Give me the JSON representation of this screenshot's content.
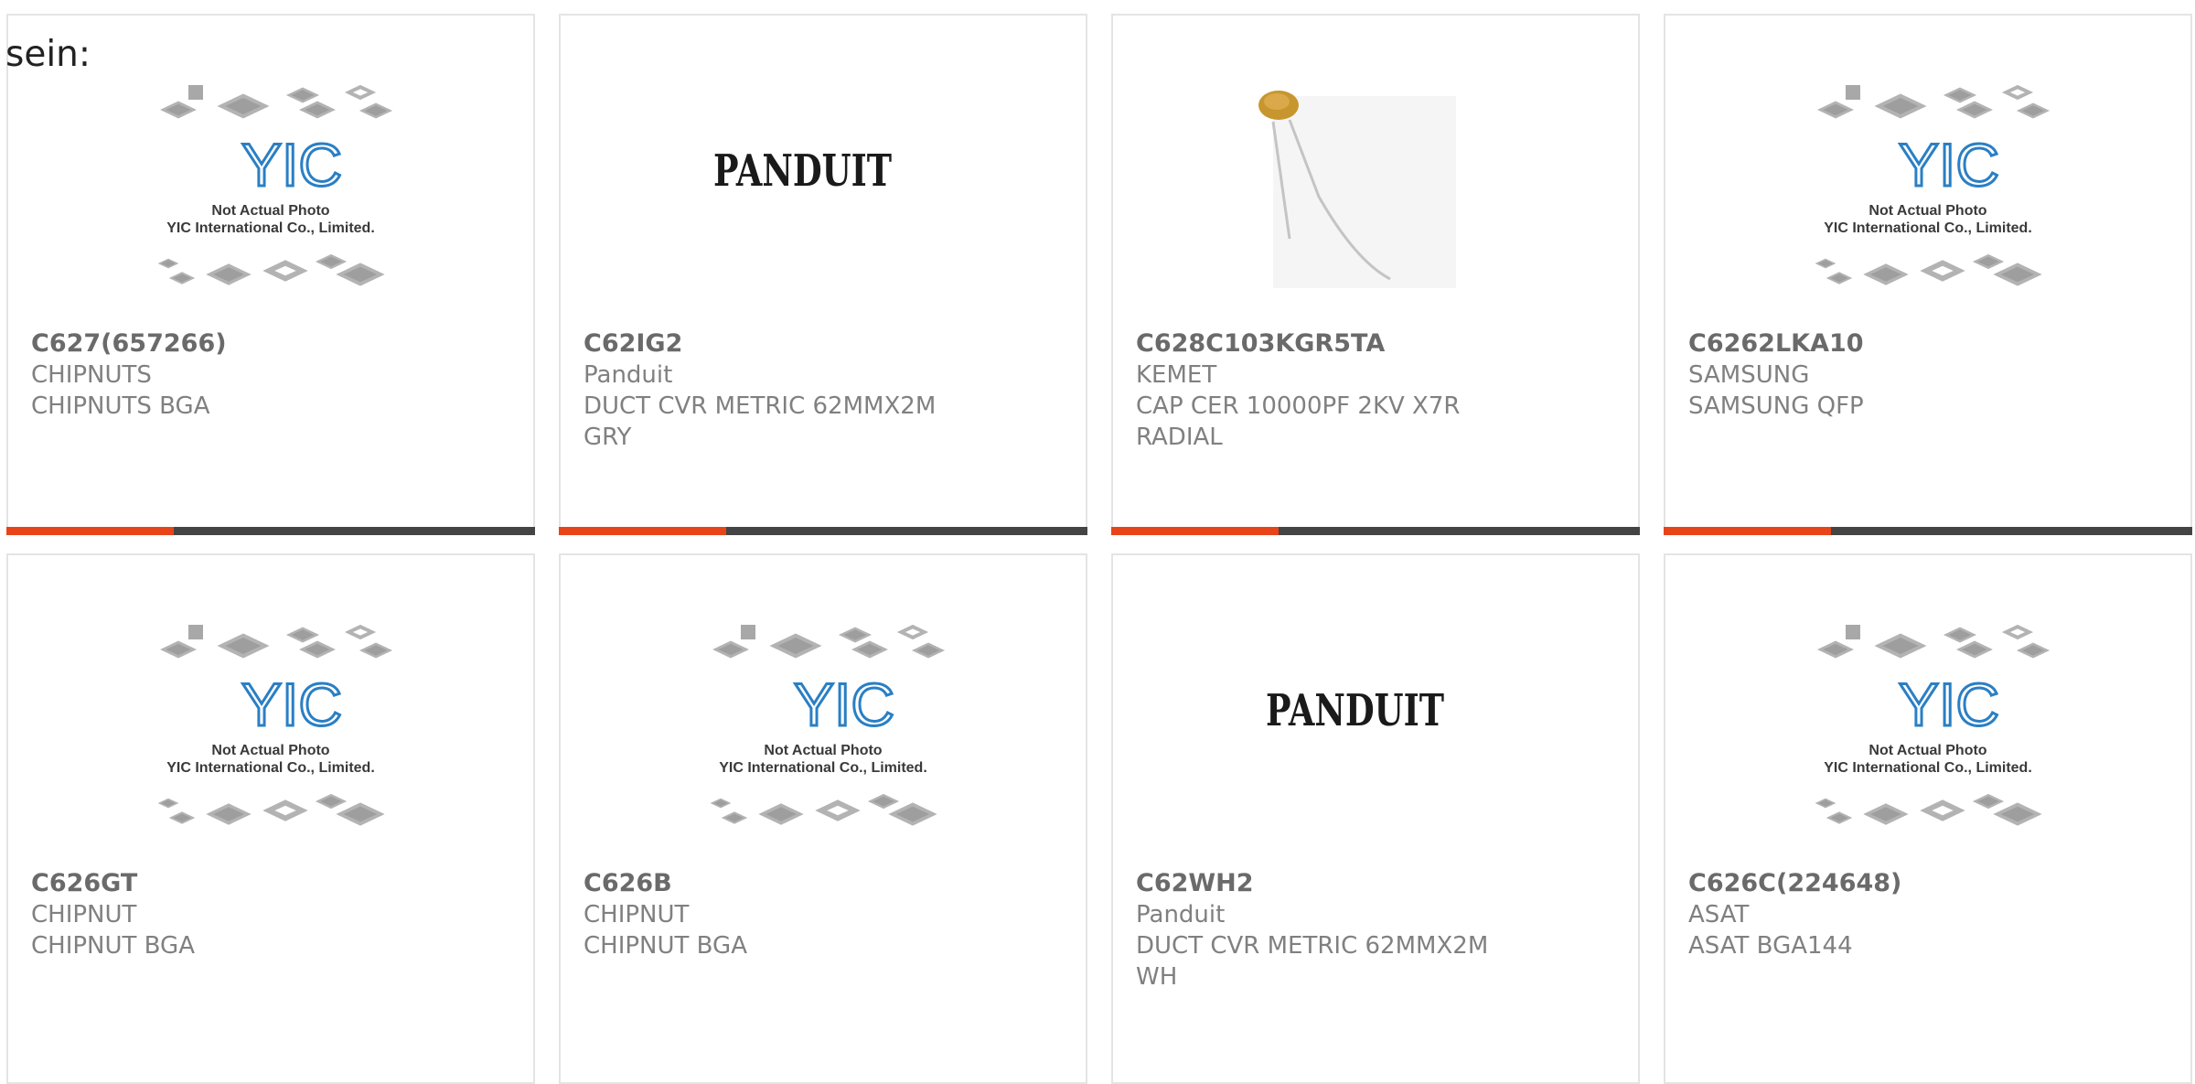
{
  "intro_text": "sein:",
  "products": [
    {
      "part_number": "C627(657266)",
      "manufacturer": "CHIPNUTS",
      "description": "CHIPNUTS BGA",
      "image": "yic-placeholder"
    },
    {
      "part_number": "C62IG2",
      "manufacturer": "Panduit",
      "description": "DUCT CVR METRIC 62MMX2M GRY",
      "image": "panduit-logo"
    },
    {
      "part_number": "C628C103KGR5TA",
      "manufacturer": "KEMET",
      "description": "CAP CER 10000PF 2KV X7R RADIAL",
      "image": "capacitor-photo"
    },
    {
      "part_number": "C6262LKA10",
      "manufacturer": "SAMSUNG",
      "description": "SAMSUNG QFP",
      "image": "yic-placeholder"
    },
    {
      "part_number": "C626GT",
      "manufacturer": "CHIPNUT",
      "description": "CHIPNUT BGA",
      "image": "yic-placeholder"
    },
    {
      "part_number": "C626B",
      "manufacturer": "CHIPNUT",
      "description": "CHIPNUT BGA",
      "image": "yic-placeholder"
    },
    {
      "part_number": "C62WH2",
      "manufacturer": "Panduit",
      "description": "DUCT CVR METRIC 62MMX2M WH",
      "image": "panduit-logo"
    },
    {
      "part_number": "C626C(224648)",
      "manufacturer": "ASAT",
      "description": "ASAT BGA144",
      "image": "yic-placeholder"
    }
  ],
  "placeholder": {
    "caption_line1": "Not Actual Photo",
    "caption_line2": "YIC International Co., Limited.",
    "logo_text": "YIC"
  },
  "panduit_logo_text": "PANDUIT",
  "colors": {
    "accent": "#e8441a",
    "bar": "#444444",
    "card_border": "#e4e4e4",
    "yic_blue": "#2a7fc4"
  }
}
